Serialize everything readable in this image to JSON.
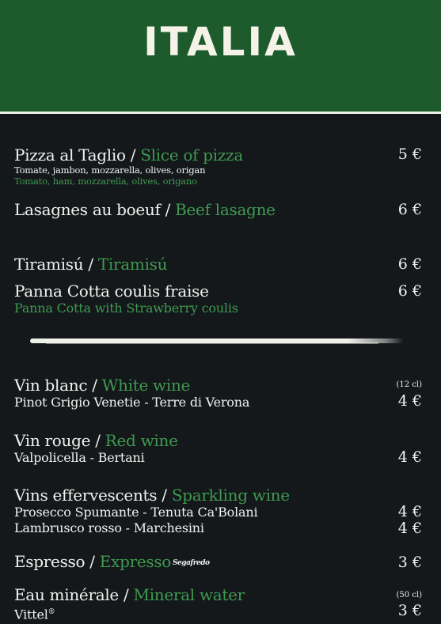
{
  "header": {
    "title": "ITALIA"
  },
  "colors": {
    "header_bg": "#1d5b2d",
    "board_bg": "#14181b",
    "accent_green": "#3f9a50",
    "text": "#f2f2ee"
  },
  "items": [
    {
      "fr": "Pizza al Taglio",
      "en": "Slice of pizza",
      "desc_fr": "Tomate, jambon, mozzarella, olives, origan",
      "desc_en": "Tomato, ham, mozzarella, olives, origano",
      "price": "5 €"
    },
    {
      "fr": "Lasagnes au boeuf",
      "en": "Beef lasagne",
      "price": "6 €"
    },
    {
      "fr": "Tiramisú",
      "en": "Tiramisú",
      "price": "6 €"
    },
    {
      "fr": "Panna Cotta coulis fraise",
      "desc_en": "Panna Cotta with Strawberry coulis",
      "price": "6 €"
    },
    {
      "fr": "Vin blanc",
      "en": "White wine",
      "volume": "(12 cl)",
      "detail": "Pinot Grigio Venetie - Terre di Verona",
      "price": "4 €"
    },
    {
      "fr": "Vin rouge",
      "en": "Red wine",
      "detail": "Valpolicella - Bertani",
      "price": "4 €"
    },
    {
      "fr": "Vins effervescents",
      "en": "Sparkling wine",
      "detail": "Prosecco Spumante - Tenuta Ca'Bolani",
      "price": "4 €",
      "detail2": "Lambrusco rosso - Marchesini",
      "price2": "4 €"
    },
    {
      "fr": "Espresso",
      "en": "Expresso",
      "brand": "Segafredo",
      "price": "3 €"
    },
    {
      "fr": "Eau minérale",
      "en": "Mineral water",
      "volume": "(50 cl)",
      "detail": "Vittel",
      "detail_mark": "®",
      "price": "3 €"
    }
  ]
}
